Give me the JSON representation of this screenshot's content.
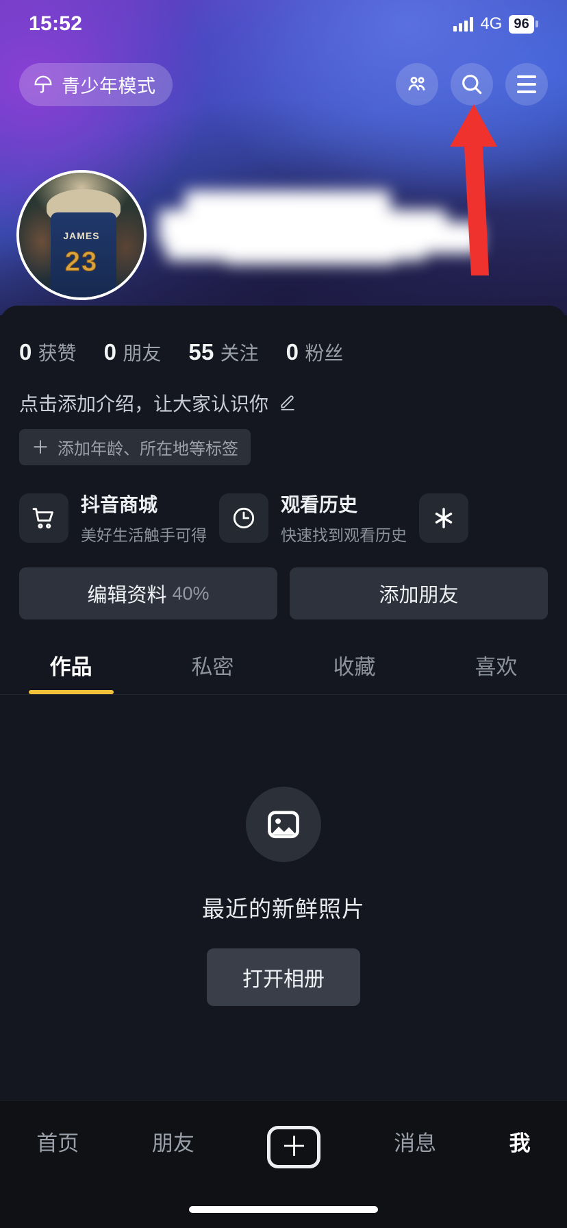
{
  "status_bar": {
    "time": "15:52",
    "network": "4G",
    "battery": "96",
    "signal_icon": "cellular-signal-icon",
    "battery_icon": "battery-icon"
  },
  "top_bar": {
    "teen_mode": {
      "label": "青少年模式",
      "icon": "umbrella-icon"
    },
    "actions": [
      {
        "name": "friends-icon",
        "label": ""
      },
      {
        "name": "search-icon",
        "label": ""
      },
      {
        "name": "menu-icon",
        "label": ""
      }
    ]
  },
  "annotation": {
    "arrow_color": "#f0322e",
    "target": "menu-icon"
  },
  "profile": {
    "avatar_alt": "JAMES 23 basketball jersey photo",
    "avatar_jersey_name": "JAMES",
    "avatar_jersey_number": "23",
    "display_name_blurred": true,
    "stats": [
      {
        "value": "0",
        "label": "获赞"
      },
      {
        "value": "0",
        "label": "朋友"
      },
      {
        "value": "55",
        "label": "关注"
      },
      {
        "value": "0",
        "label": "粉丝"
      }
    ],
    "bio_placeholder": "点击添加介绍，让大家认识你",
    "bio_edit_icon": "pencil-icon",
    "tag_add": {
      "plus": "＋",
      "label": "添加年龄、所在地等标签"
    }
  },
  "shortcuts": [
    {
      "icon": "shopping-cart-icon",
      "title": "抖音商城",
      "subtitle": "美好生活触手可得"
    },
    {
      "icon": "clock-icon",
      "title": "观看历史",
      "subtitle": "快速找到观看历史"
    },
    {
      "icon": "douyin-star-icon",
      "title": "",
      "subtitle": ""
    }
  ],
  "actions": {
    "edit_profile": {
      "label": "编辑资料",
      "percent": "40%"
    },
    "add_friend": {
      "label": "添加朋友"
    }
  },
  "tabs": [
    {
      "label": "作品",
      "active": true
    },
    {
      "label": "私密",
      "active": false
    },
    {
      "label": "收藏",
      "active": false
    },
    {
      "label": "喜欢",
      "active": false
    }
  ],
  "empty_state": {
    "icon": "image-placeholder-icon",
    "title": "最近的新鲜照片",
    "button": "打开相册"
  },
  "bottom_nav": [
    {
      "label": "首页",
      "active": false
    },
    {
      "label": "朋友",
      "active": false
    },
    {
      "label": "＋",
      "active": false,
      "is_plus": true
    },
    {
      "label": "消息",
      "active": false
    },
    {
      "label": "我",
      "active": true
    }
  ],
  "colors": {
    "accent_yellow": "#f3c23b",
    "background": "#14171f",
    "tabbar": "#101114",
    "annotation_red": "#f0322e"
  }
}
